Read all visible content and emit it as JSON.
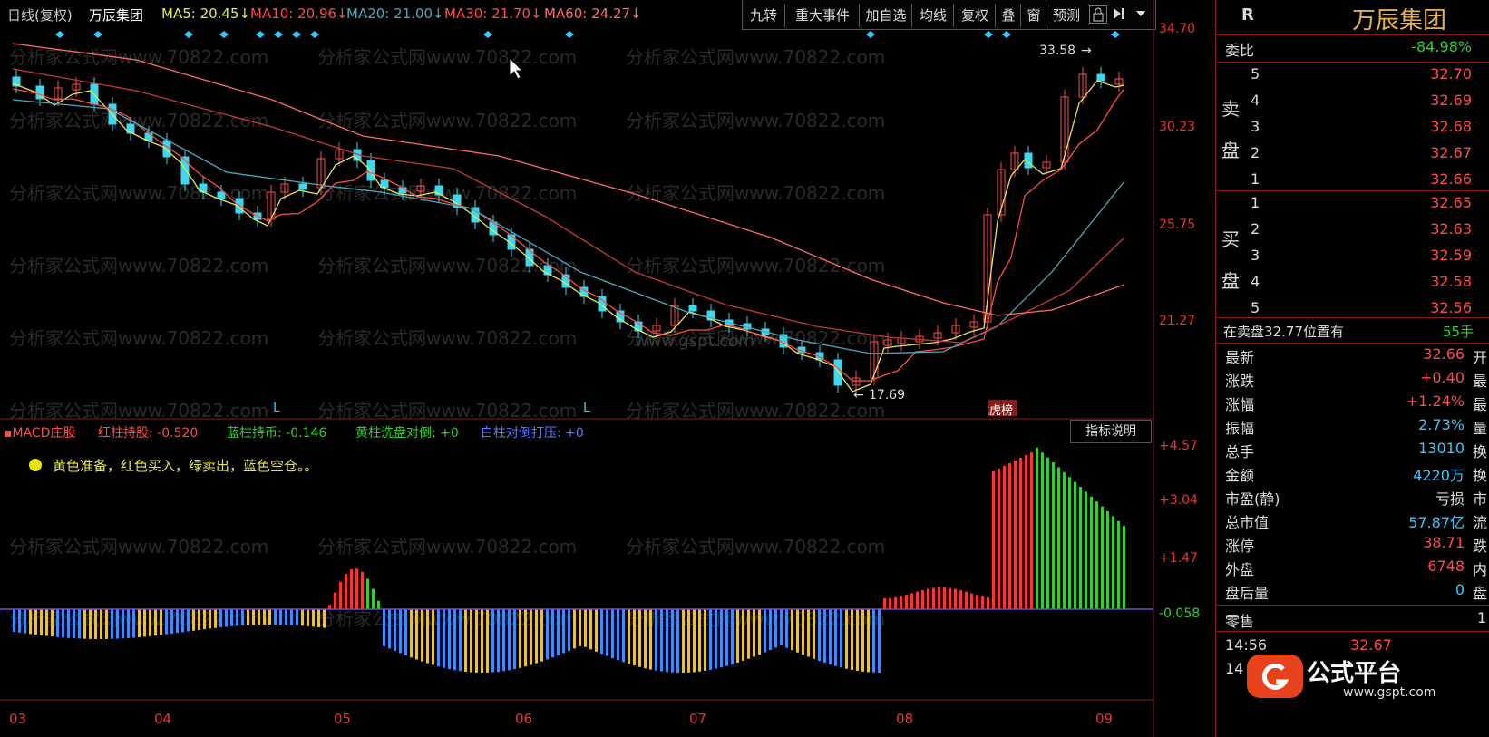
{
  "header": {
    "period": "日线(复权)",
    "stock_name": "万辰集团",
    "ma": [
      {
        "label": "MA5: 20.45",
        "color": "#e6e65a"
      },
      {
        "label": "MA10: 20.96",
        "color": "#ff4b4b"
      },
      {
        "label": "MA20: 21.00",
        "color": "#4fa8b8"
      },
      {
        "label": "MA30: 21.70",
        "color": "#ff4b4b"
      },
      {
        "label": "MA60: 24.27",
        "color": "#ff6b6b"
      }
    ],
    "arrow_glyph": "↓"
  },
  "toolbar": [
    "九转",
    "重大事件",
    "加自选",
    "均线",
    "复权",
    "叠",
    "窗",
    "预测"
  ],
  "toolbar_icons": [
    "lock-icon",
    "play-arrow-icon",
    "dropdown-icon"
  ],
  "y_axis_main": [
    "34.70",
    "30.23",
    "25.75",
    "21.27"
  ],
  "y_axis_macd": [
    "+4.57",
    "+3.04",
    "+1.47",
    "-0.058"
  ],
  "x_axis": [
    "03",
    "04",
    "05",
    "06",
    "07",
    "08",
    "09"
  ],
  "annotations": {
    "high": "33.58",
    "low": "17.69",
    "signal_marks": [
      "L",
      "L"
    ],
    "list_tag": "龙虎榜"
  },
  "watermarks": [
    "分析家公式网www.70822.com",
    "www.gspt.com"
  ],
  "macd": {
    "title": "MACD庄股",
    "red_label": "红柱持股: -0.520",
    "blue_label": "蓝柱持币: -0.146",
    "yellow_label": "黄柱洗盘对倒: +0",
    "white_label": "白柱对倒打压: +0",
    "note": "黄色准备，红色买入，绿卖出，蓝色空仓。。",
    "button": "指标说明"
  },
  "side": {
    "code_badge": "R",
    "name": "万辰集团",
    "weibi_label": "委比",
    "weibi_value": "-84.98%",
    "sell_label": [
      "卖",
      "盘"
    ],
    "buy_label": [
      "买",
      "盘"
    ],
    "sell": [
      {
        "lvl": "5",
        "price": "32.70"
      },
      {
        "lvl": "4",
        "price": "32.69"
      },
      {
        "lvl": "3",
        "price": "32.68"
      },
      {
        "lvl": "2",
        "price": "32.67"
      },
      {
        "lvl": "1",
        "price": "32.66"
      }
    ],
    "buy": [
      {
        "lvl": "1",
        "price": "32.65"
      },
      {
        "lvl": "2",
        "price": "32.63"
      },
      {
        "lvl": "3",
        "price": "32.59"
      },
      {
        "lvl": "4",
        "price": "32.58"
      },
      {
        "lvl": "5",
        "price": "32.56"
      }
    ],
    "position_note": "在卖盘32.77位置有",
    "position_hands": "55手",
    "stats": [
      {
        "k": "最新",
        "v": "32.66",
        "c": "#ff4b4b",
        "e": "开"
      },
      {
        "k": "涨跌",
        "v": "+0.40",
        "c": "#ff4b4b",
        "e": "最"
      },
      {
        "k": "涨幅",
        "v": "+1.24%",
        "c": "#ff4b4b",
        "e": "最"
      },
      {
        "k": "振幅",
        "v": "2.73%",
        "c": "#3bc6ff",
        "e": "量"
      },
      {
        "k": "总手",
        "v": "13010",
        "c": "#3bc6ff",
        "e": "换"
      },
      {
        "k": "金额",
        "v": "4220万",
        "c": "#3bc6ff",
        "e": "换"
      },
      {
        "k": "市盈(静)",
        "v": "亏损",
        "c": "#dddddd",
        "e": "市"
      },
      {
        "k": "总市值",
        "v": "57.87亿",
        "c": "#3bc6ff",
        "e": "流"
      },
      {
        "k": "涨停",
        "v": "38.71",
        "c": "#ff4b4b",
        "e": "跌"
      },
      {
        "k": "外盘",
        "v": "6748",
        "c": "#ff4b4b",
        "e": "内"
      },
      {
        "k": "盘后量",
        "v": "0",
        "c": "#3bc6ff",
        "e": "盘"
      }
    ],
    "retail_label": "零售",
    "retail_edge": "1",
    "ticks": [
      {
        "time": "14:56",
        "price": "32.67"
      },
      {
        "time": "14",
        "price": ""
      }
    ],
    "logo_text": "公式平台",
    "logo_url_text": "www.gspt.com"
  },
  "chart_data": {
    "type": "candlestick",
    "price_range": [
      16.8,
      34.7
    ],
    "ma_lines": [
      "MA5",
      "MA10",
      "MA20",
      "MA30",
      "MA60"
    ],
    "high": 33.58,
    "low": 17.69,
    "macd_range": [
      -0.9,
      4.57
    ]
  }
}
